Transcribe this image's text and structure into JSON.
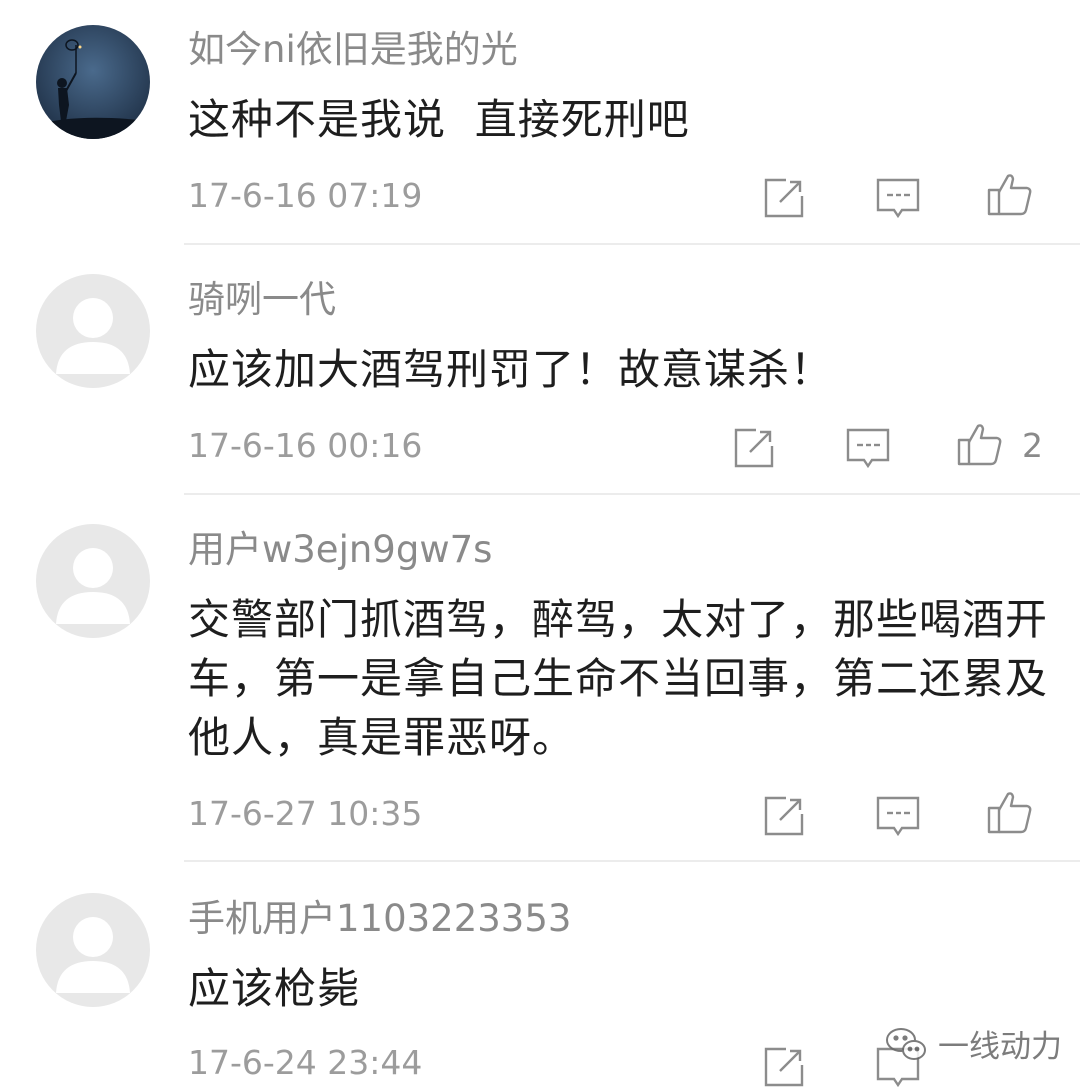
{
  "comments": [
    {
      "username": "如今ni依旧是我的光",
      "content": "这种不是我说  直接死刑吧",
      "timestamp": "17-6-16 07:19",
      "likes": "",
      "avatar": "night-silhouette"
    },
    {
      "username": "骑咧一代",
      "content": "应该加大酒驾刑罚了！故意谋杀！",
      "timestamp": "17-6-16 00:16",
      "likes": "2",
      "avatar": "default-user"
    },
    {
      "username": "用户w3ejn9gw7s",
      "content": "交警部门抓酒驾，醉驾，太对了，那些喝酒开车，第一是拿自己生命不当回事，第二还累及他人，真是罪恶呀。",
      "timestamp": "17-6-27 10:35",
      "likes": "",
      "avatar": "default-user"
    },
    {
      "username": "手机用户1103223353",
      "content": "应该枪毙",
      "timestamp": "17-6-24 23:44",
      "likes": "",
      "avatar": "default-user"
    }
  ],
  "actions": {
    "edit_icon": "share-edit-icon",
    "reply_icon": "comment-bubble-icon",
    "like_icon": "thumbs-up-icon"
  },
  "watermark": {
    "text": "一线动力",
    "icon": "wechat-icon"
  },
  "colors": {
    "username": "#8a8a8a",
    "content": "#1e1e1e",
    "timestamp": "#9c9c9c",
    "icon": "#8c8c8c",
    "divider": "#ececec"
  }
}
